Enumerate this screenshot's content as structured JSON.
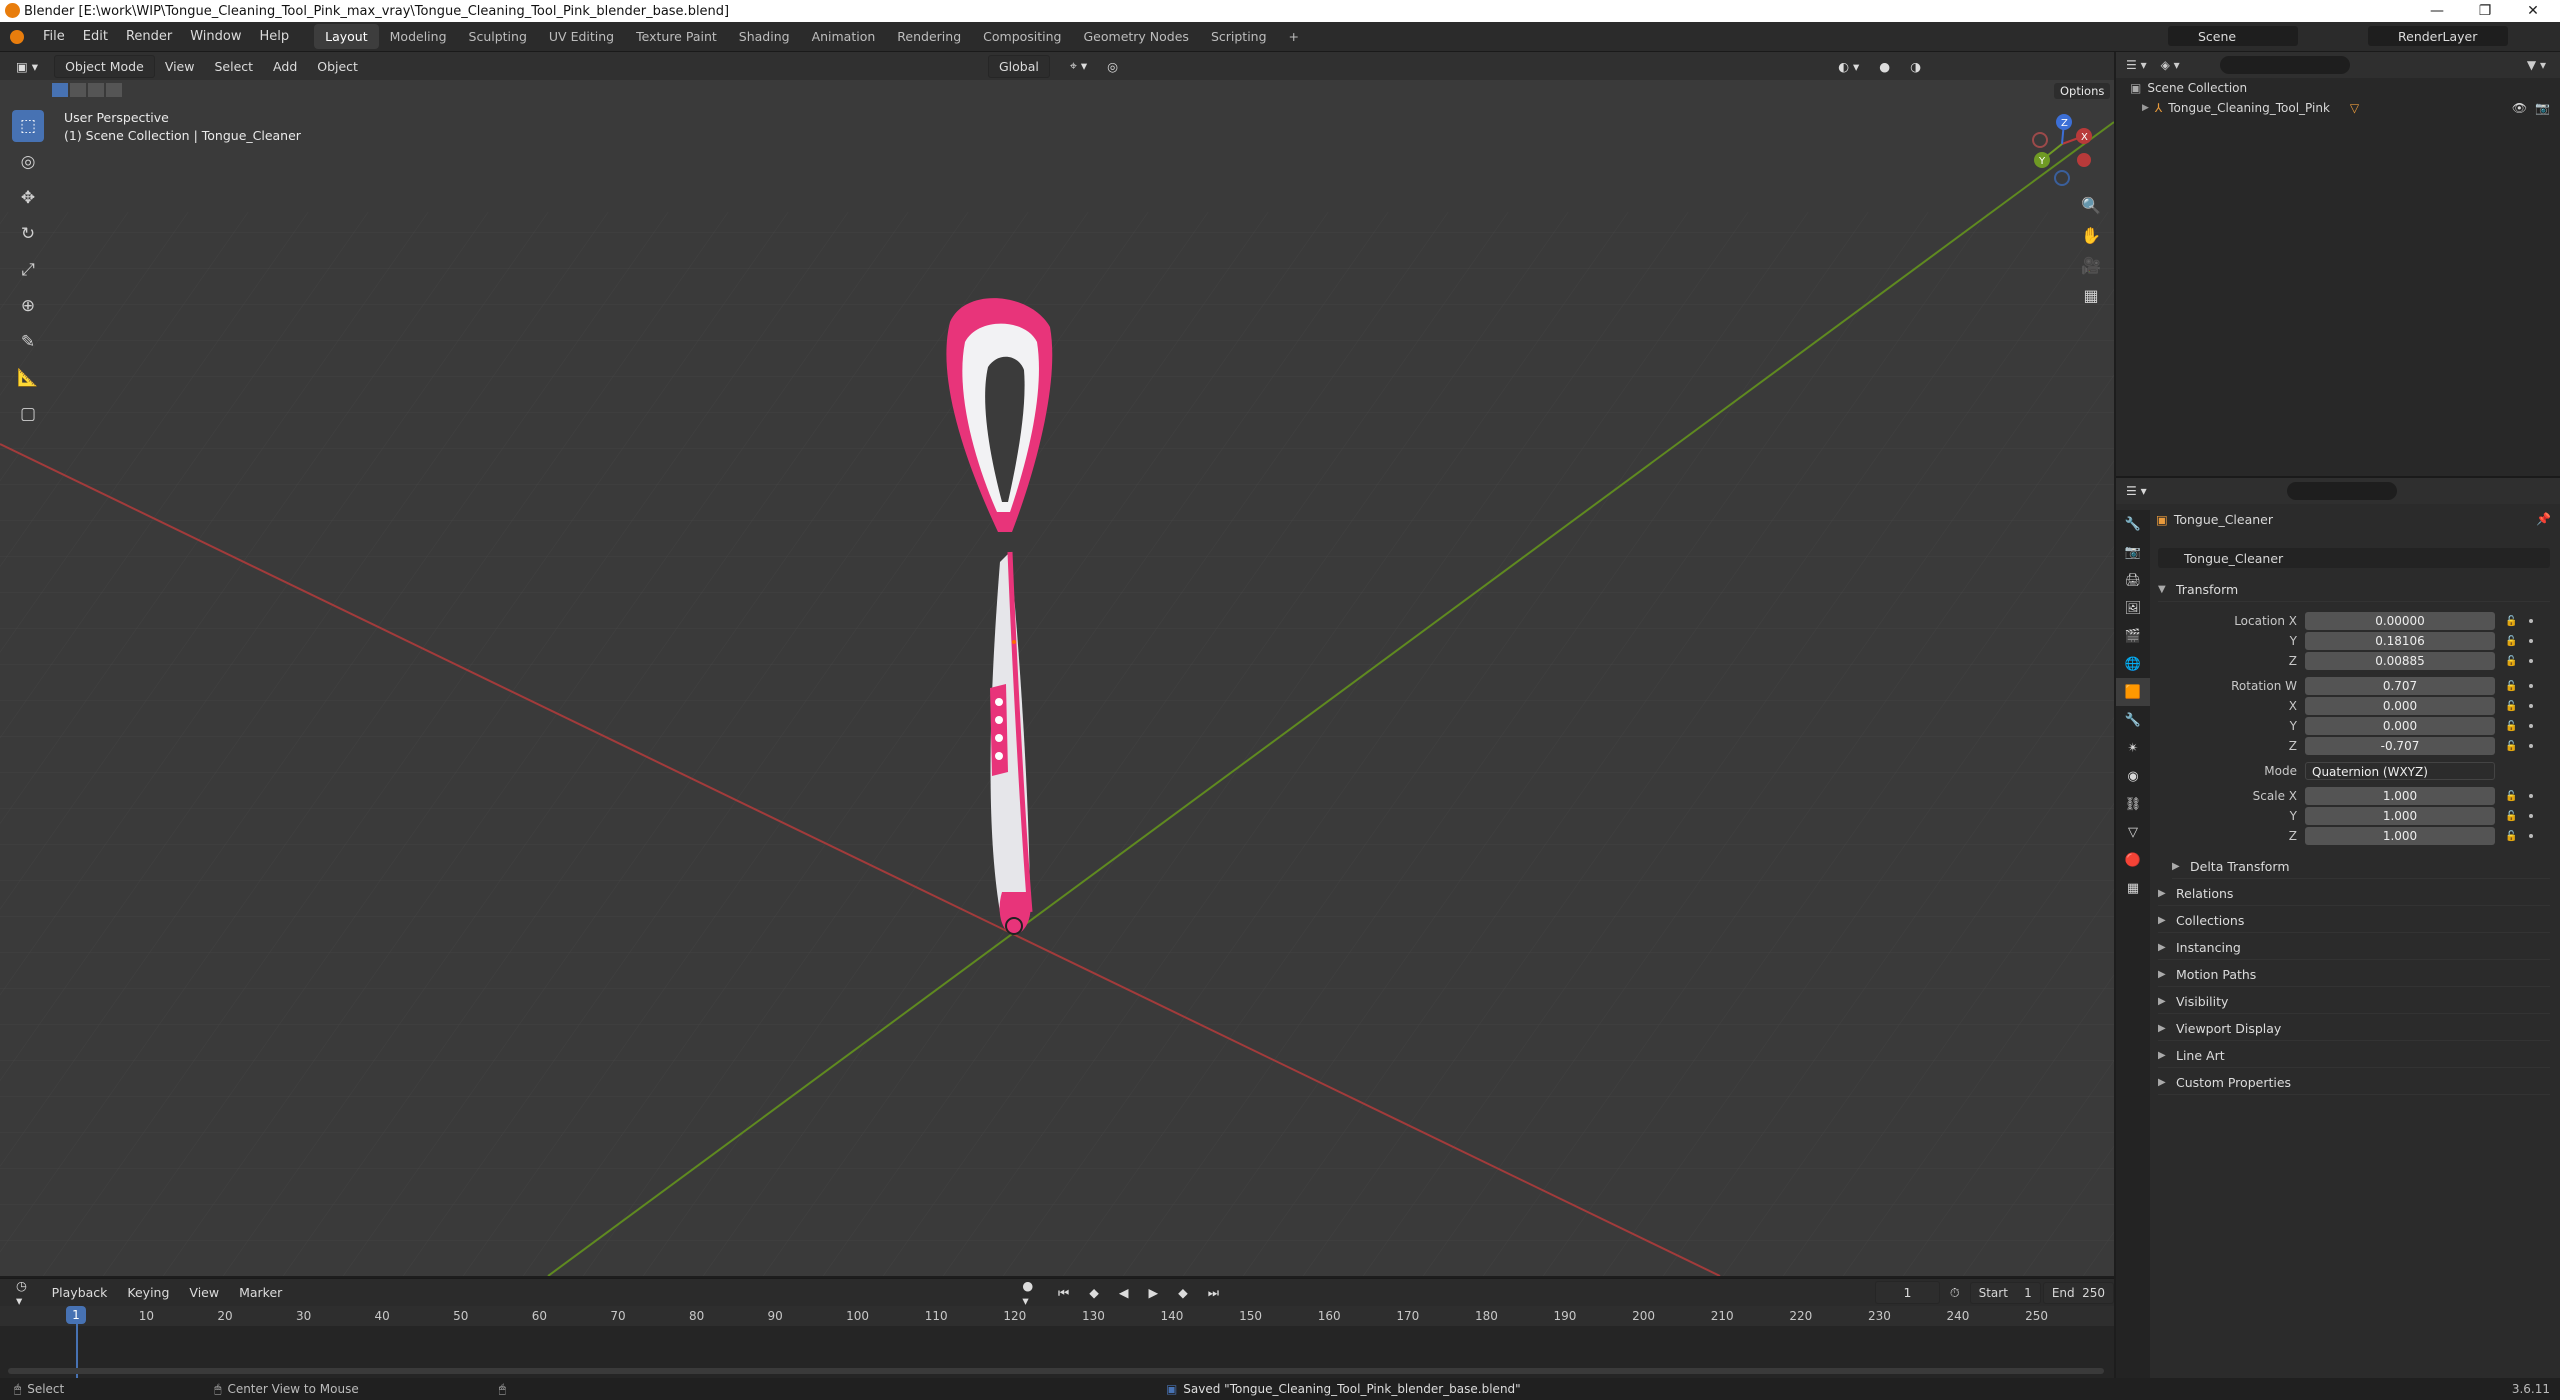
{
  "window": {
    "title": "Blender [E:\\work\\WIP\\Tongue_Cleaning_Tool_Pink_max_vray\\Tongue_Cleaning_Tool_Pink_blender_base.blend]",
    "minimize": "—",
    "maximize": "❐",
    "close": "✕"
  },
  "menu": [
    "File",
    "Edit",
    "Render",
    "Window",
    "Help"
  ],
  "workspaces": [
    "Layout",
    "Modeling",
    "Sculpting",
    "UV Editing",
    "Texture Paint",
    "Shading",
    "Animation",
    "Rendering",
    "Compositing",
    "Geometry Nodes",
    "Scripting"
  ],
  "workspace_add": "+",
  "scene": {
    "name": "Scene",
    "render_layer": "RenderLayer"
  },
  "viewport": {
    "mode": "Object Mode",
    "menus": [
      "View",
      "Select",
      "Add",
      "Object"
    ],
    "transform_orientation": "Global",
    "options_label": "Options",
    "perspective_label": "User Perspective",
    "collection_label": "(1) Scene Collection | Tongue_Cleaner",
    "gizmo_axes": [
      "X",
      "Y",
      "Z"
    ]
  },
  "outliner": {
    "root": "Scene Collection",
    "items": [
      {
        "label": "Tongue_Cleaning_Tool_Pink"
      }
    ]
  },
  "properties": {
    "object_name": "Tongue_Cleaner",
    "data_name": "Tongue_Cleaner",
    "transform_label": "Transform",
    "location": {
      "label": "Location X",
      "x": "0.00000",
      "y": "0.18106",
      "z": "0.00885"
    },
    "rotation": {
      "label": "Rotation W",
      "w": "0.707",
      "x": "0.000",
      "y": "0.000",
      "z": "-0.707"
    },
    "mode": {
      "label": "Mode",
      "value": "Quaternion (WXYZ)"
    },
    "scale": {
      "label": "Scale X",
      "x": "1.000",
      "y": "1.000",
      "z": "1.000"
    },
    "axis_labels": {
      "y": "Y",
      "z": "Z",
      "x": "X"
    },
    "delta_transform": "Delta Transform",
    "sections": [
      "Relations",
      "Collections",
      "Instancing",
      "Motion Paths",
      "Visibility",
      "Viewport Display",
      "Line Art",
      "Custom Properties"
    ]
  },
  "timeline": {
    "menus": [
      "Playback",
      "Keying",
      "View",
      "Marker"
    ],
    "current_frame": "1",
    "start_label": "Start",
    "start": "1",
    "end_label": "End",
    "end": "250",
    "ruler": [
      "10",
      "20",
      "30",
      "40",
      "50",
      "60",
      "70",
      "80",
      "90",
      "100",
      "110",
      "120",
      "130",
      "140",
      "150",
      "160",
      "170",
      "180",
      "190",
      "200",
      "210",
      "220",
      "230",
      "240",
      "250"
    ],
    "playhead": "1"
  },
  "status": {
    "select": "Select",
    "center_view": "Center View to Mouse",
    "message": "Saved \"Tongue_Cleaning_Tool_Pink_blender_base.blend\"",
    "version": "3.6.11"
  },
  "colors": {
    "accent": "#4772b3",
    "pink": "#e8347a",
    "x_axis": "#b83a3a",
    "y_axis": "#6f9a24",
    "z_axis": "#3c6fd6"
  }
}
